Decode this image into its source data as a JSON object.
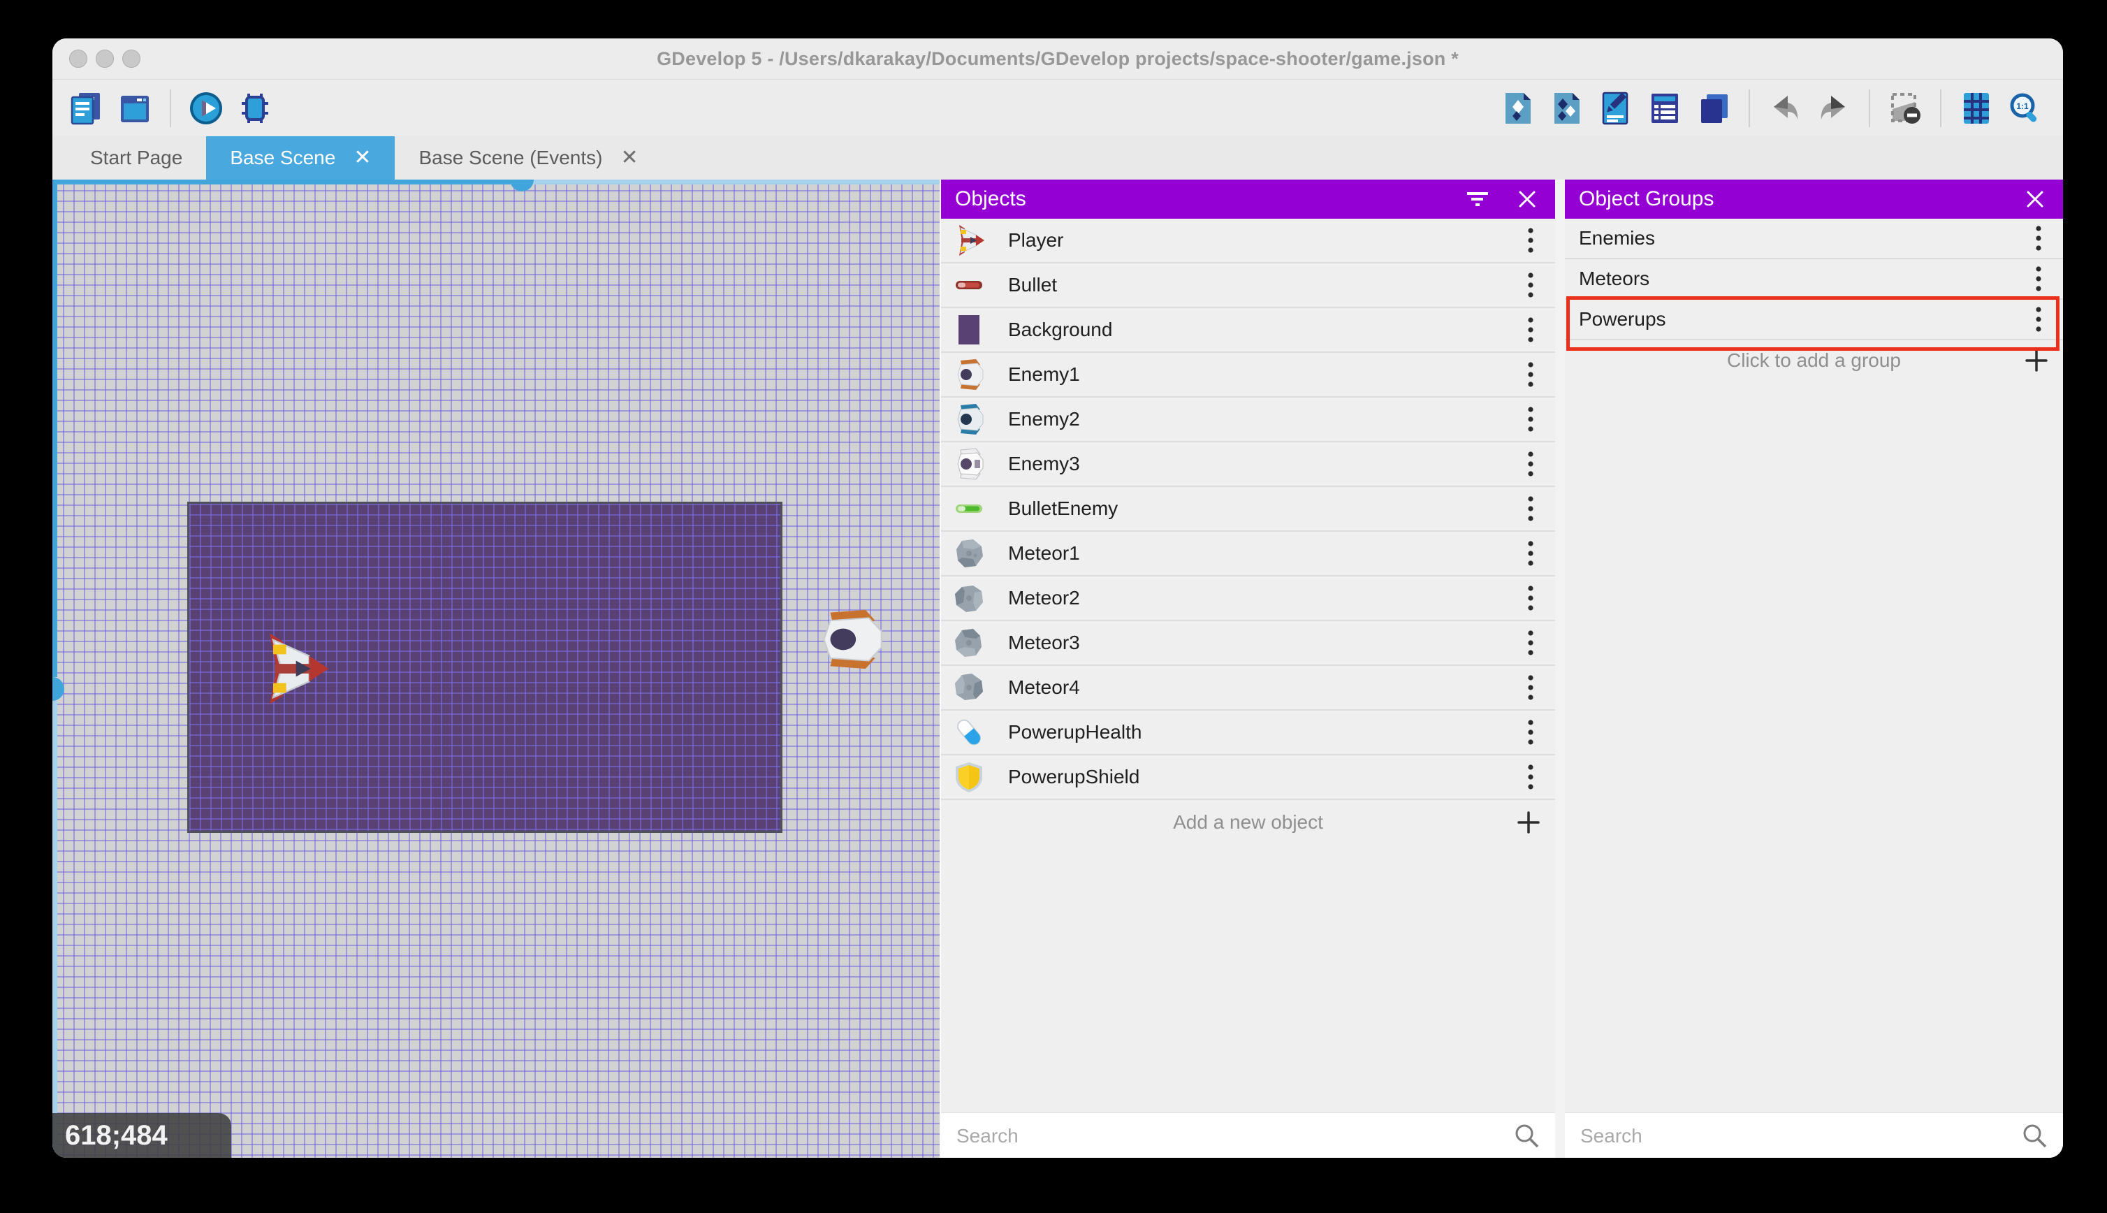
{
  "window": {
    "title": "GDevelop 5 - /Users/dkarakay/Documents/GDevelop projects/space-shooter/game.json *",
    "traffic_lights": [
      "close",
      "minimize",
      "zoom"
    ]
  },
  "toolbar": {
    "left_groups": [
      [
        "project-manager",
        "scene-window"
      ],
      [
        "play",
        "debug"
      ]
    ],
    "right_groups": [
      [
        "objects-editor",
        "object-groups",
        "properties",
        "instances-list",
        "layers"
      ],
      [
        "undo",
        "redo"
      ],
      [
        "mask-toggle"
      ],
      [
        "grid",
        "zoom-1-1"
      ]
    ]
  },
  "tabs": {
    "items": [
      {
        "label": "Start Page",
        "active": false,
        "closable": false
      },
      {
        "label": "Base Scene",
        "active": true,
        "closable": true
      },
      {
        "label": "Base Scene (Events)",
        "active": false,
        "closable": true
      }
    ],
    "close_glyph": "✕"
  },
  "canvas": {
    "coordinate_label": "618;484",
    "scene_background_color": "#5a4173",
    "instances": [
      "Player",
      "Enemy1"
    ]
  },
  "objects_panel": {
    "title": "Objects",
    "items": [
      {
        "label": "Player",
        "thumb": "player"
      },
      {
        "label": "Bullet",
        "thumb": "bullet"
      },
      {
        "label": "Background",
        "thumb": "background"
      },
      {
        "label": "Enemy1",
        "thumb": "enemy1"
      },
      {
        "label": "Enemy2",
        "thumb": "enemy2"
      },
      {
        "label": "Enemy3",
        "thumb": "enemy3"
      },
      {
        "label": "BulletEnemy",
        "thumb": "bullet-enemy"
      },
      {
        "label": "Meteor1",
        "thumb": "meteor1"
      },
      {
        "label": "Meteor2",
        "thumb": "meteor2"
      },
      {
        "label": "Meteor3",
        "thumb": "meteor3"
      },
      {
        "label": "Meteor4",
        "thumb": "meteor4"
      },
      {
        "label": "PowerupHealth",
        "thumb": "powerup-health"
      },
      {
        "label": "PowerupShield",
        "thumb": "powerup-shield"
      }
    ],
    "add_label": "Add a new object",
    "search_placeholder": "Search"
  },
  "groups_panel": {
    "title": "Object Groups",
    "items": [
      {
        "label": "Enemies",
        "highlighted": false
      },
      {
        "label": "Meteors",
        "highlighted": false
      },
      {
        "label": "Powerups",
        "highlighted": true
      }
    ],
    "add_label": "Click to add a group",
    "search_placeholder": "Search"
  },
  "colors": {
    "panel_header_purple": "#9400d3",
    "tab_active_blue": "#49a8dd",
    "annotation_red": "#e8301d",
    "canvas_grid_line": "#685fe0",
    "canvas_background": "#d2d2d2"
  }
}
